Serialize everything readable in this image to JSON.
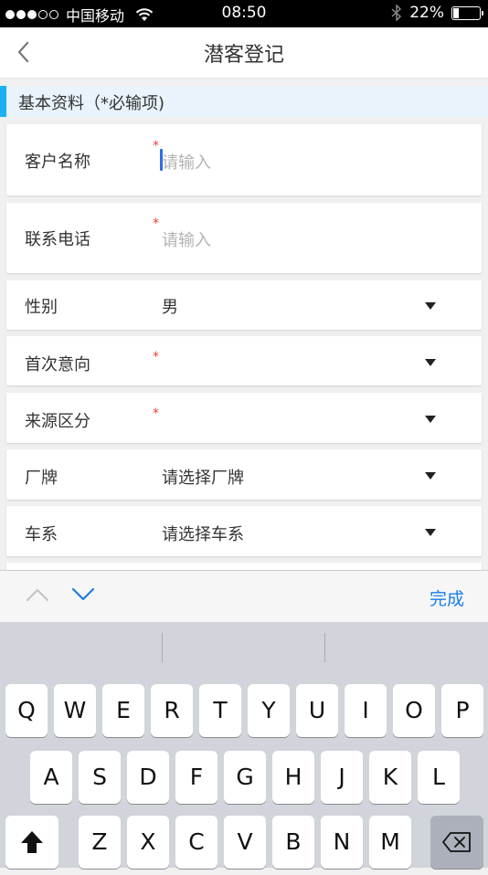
{
  "status_bar": {
    "carrier": "中国移动",
    "time": "08:50",
    "battery": "22%",
    "battery_level": 0.22
  },
  "nav": {
    "title": "潜客登记"
  },
  "section": {
    "title": "基本资料（*必输项)"
  },
  "form": {
    "rows": [
      {
        "label": "客户名称",
        "required": true,
        "value": "请输入",
        "type": "text",
        "focused": true
      },
      {
        "label": "联系电话",
        "required": true,
        "value": "请输入",
        "type": "text"
      },
      {
        "label": "性别",
        "required": false,
        "value": "男",
        "type": "select"
      },
      {
        "label": "首次意向",
        "required": true,
        "value": "",
        "type": "select"
      },
      {
        "label": "来源区分",
        "required": true,
        "value": "",
        "type": "select"
      },
      {
        "label": "厂牌",
        "required": false,
        "value": "请选择厂牌",
        "type": "select"
      },
      {
        "label": "车系",
        "required": false,
        "value": "请选择车系",
        "type": "select"
      }
    ],
    "required_mark": "*"
  },
  "accessory": {
    "done_label": "完成"
  },
  "keyboard": {
    "row1": [
      "Q",
      "W",
      "E",
      "R",
      "T",
      "Y",
      "U",
      "I",
      "O",
      "P"
    ],
    "row2": [
      "A",
      "S",
      "D",
      "F",
      "G",
      "H",
      "J",
      "K",
      "L"
    ],
    "row3": [
      "Z",
      "X",
      "C",
      "V",
      "B",
      "N",
      "M"
    ]
  }
}
